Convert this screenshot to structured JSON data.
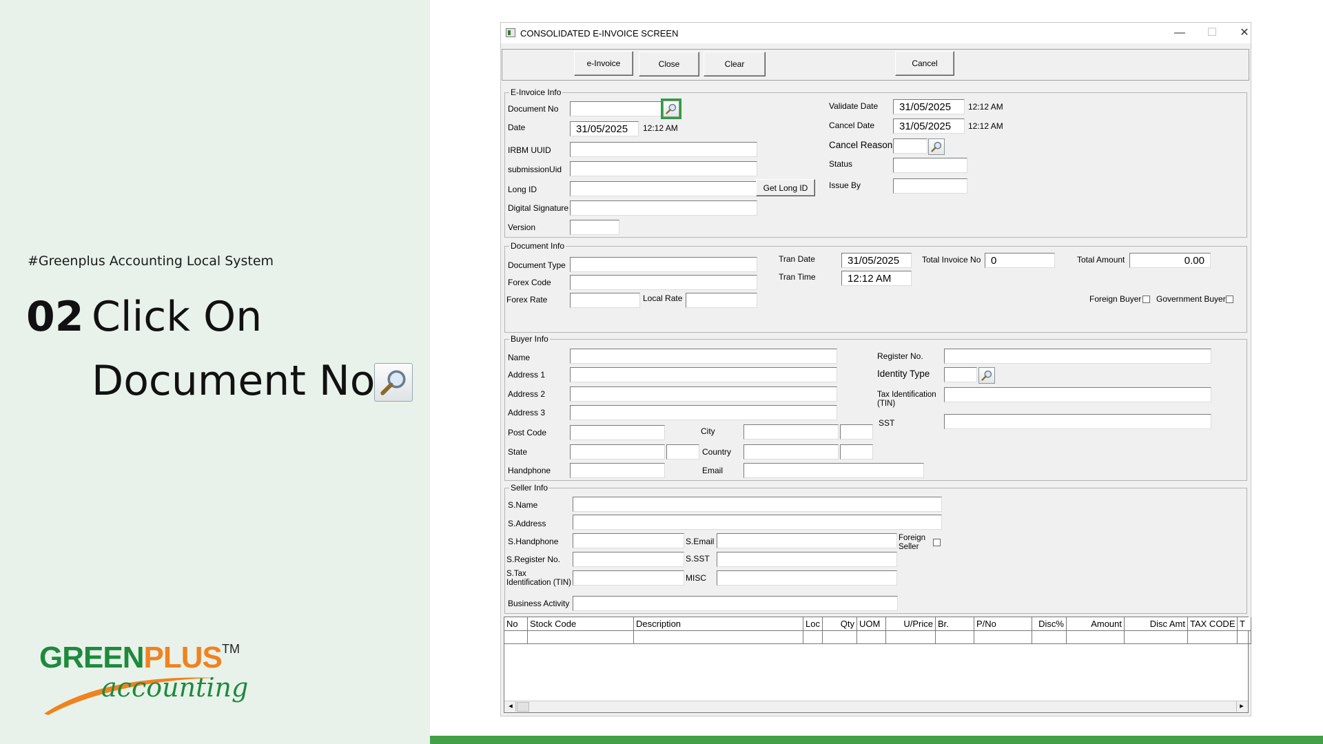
{
  "slide": {
    "hashtag": "#Greenplus Accounting Local System",
    "step_number": "02",
    "step_line1": "Click On",
    "step_line2": "Document No",
    "logo_word1": "GREEN",
    "logo_word2": "PLUS",
    "logo_tm": "TM",
    "logo_sub": "accounting"
  },
  "window": {
    "title": "CONSOLIDATED E-INVOICE SCREEN",
    "minimize": "—",
    "maximize": "☐",
    "close": "✕"
  },
  "toolbar": {
    "einvoice": "e-Invoice",
    "close": "Close",
    "clear": "Clear",
    "cancel": "Cancel"
  },
  "einvoice_info": {
    "legend": "E-Invoice Info",
    "document_no_label": "Document No",
    "document_no_value": "",
    "date_label": "Date",
    "date_value": "31/05/2025",
    "date_time": "12:12 AM",
    "irbm_uuid_label": "IRBM UUID",
    "submission_uid_label": "submissionUid",
    "long_id_label": "Long ID",
    "get_long_id": "Get Long ID",
    "digital_signature_label": "Digital Signature",
    "version_label": "Version",
    "validate_date_label": "Validate Date",
    "validate_date_value": "31/05/2025",
    "validate_time": "12:12 AM",
    "cancel_date_label": "Cancel Date",
    "cancel_date_value": "31/05/2025",
    "cancel_time": "12:12 AM",
    "cancel_reason_label": "Cancel Reason",
    "status_label": "Status",
    "issue_by_label": "Issue By"
  },
  "document_info": {
    "legend": "Document Info",
    "document_type_label": "Document Type",
    "forex_code_label": "Forex Code",
    "forex_rate_label": "Forex Rate",
    "local_rate_label": "Local Rate",
    "tran_date_label": "Tran Date",
    "tran_date_value": "31/05/2025",
    "tran_time_label": "Tran Time",
    "tran_time_value": "12:12 AM",
    "total_invoice_no_label": "Total Invoice No",
    "total_invoice_no_value": "0",
    "total_amount_label": "Total Amount",
    "total_amount_value": "0.00",
    "foreign_buyer_label": "Foreign Buyer",
    "government_buyer_label": "Government Buyer"
  },
  "buyer_info": {
    "legend": "Buyer Info",
    "name_label": "Name",
    "address1_label": "Address 1",
    "address2_label": "Address 2",
    "address3_label": "Address 3",
    "post_code_label": "Post Code",
    "city_label": "City",
    "state_label": "State",
    "country_label": "Country",
    "handphone_label": "Handphone",
    "email_label": "Email",
    "register_no_label": "Register No.",
    "identity_type_label": "Identity Type",
    "tin_label_1": "Tax Identification",
    "tin_label_2": "(TIN)",
    "sst_label": "SST"
  },
  "seller_info": {
    "legend": "Seller Info",
    "name_label": "S.Name",
    "address_label": "S.Address",
    "handphone_label": "S.Handphone",
    "email_label": "S.Email",
    "foreign_seller_1": "Foreign",
    "foreign_seller_2": "Seller",
    "register_no_label": "S.Register No.",
    "sst_label": "S.SST",
    "tin_label_1": "S.Tax",
    "tin_label_2": "Identification (TIN)",
    "misc_label": "MISC",
    "business_activity_label": "Business Activity"
  },
  "grid": {
    "columns": [
      "No",
      "Stock Code",
      "Description",
      "Loc",
      "Qty",
      "UOM",
      "U/Price",
      "Br.",
      "P/No",
      "Disc%",
      "Amount",
      "Disc Amt",
      "TAX CODE",
      "T"
    ],
    "scroll_left": "◂",
    "scroll_right": "▸"
  }
}
